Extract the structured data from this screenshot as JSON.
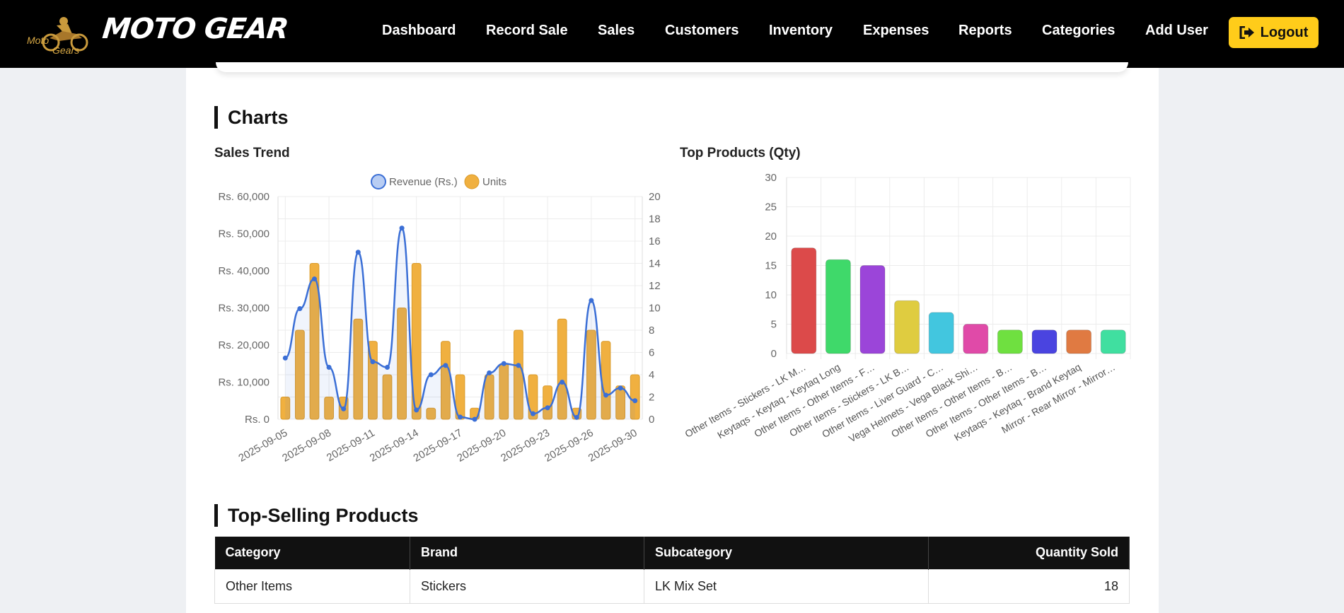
{
  "brand": {
    "name": "MOTO GEAR",
    "logo_text": [
      "Moto",
      "Gears"
    ]
  },
  "nav": [
    {
      "label": "Dashboard"
    },
    {
      "label": "Record Sale"
    },
    {
      "label": "Sales"
    },
    {
      "label": "Customers"
    },
    {
      "label": "Inventory"
    },
    {
      "label": "Expenses"
    },
    {
      "label": "Reports"
    },
    {
      "label": "Categories"
    },
    {
      "label": "Add User"
    }
  ],
  "logout": {
    "label": "Logout",
    "icon": "sign-out-icon"
  },
  "charts_section": {
    "title": "Charts"
  },
  "colors": {
    "accent": "#ffcc1a",
    "nav_bg": "#000000",
    "line": "#3b6fd6",
    "bar": "#f0b040"
  },
  "chart_data": [
    {
      "type": "bar+line",
      "title": "Sales Trend",
      "legend": [
        "Revenue (Rs.)",
        "Units"
      ],
      "legend_position": "top",
      "x_tick_labels": [
        "2025-09-05",
        "2025-09-08",
        "2025-09-11",
        "2025-09-14",
        "2025-09-17",
        "2025-09-20",
        "2025-09-23",
        "2025-09-26",
        "2025-09-30"
      ],
      "y_left_ticks": [
        "Rs. 0",
        "Rs. 10,000",
        "Rs. 20,000",
        "Rs. 30,000",
        "Rs. 40,000",
        "Rs. 50,000",
        "Rs. 60,000"
      ],
      "y_right_ticks": [
        "0",
        "2",
        "4",
        "6",
        "8",
        "10",
        "12",
        "14",
        "16",
        "18",
        "20"
      ],
      "y_left_lim": [
        0,
        60000
      ],
      "y_right_lim": [
        0,
        20
      ],
      "grid": true,
      "series": [
        {
          "name": "Units",
          "axis": "right",
          "values": [
            2,
            8,
            14,
            2,
            2,
            9,
            7,
            4,
            10,
            14,
            1,
            7,
            4,
            1,
            4,
            5,
            8,
            4,
            3,
            9,
            1,
            8,
            7,
            3,
            4
          ]
        },
        {
          "name": "Revenue (Rs.)",
          "axis": "left",
          "values": [
            16500,
            29800,
            37800,
            14000,
            2800,
            45000,
            15500,
            14000,
            51500,
            2500,
            12000,
            14500,
            600,
            0,
            12500,
            15000,
            14500,
            1500,
            3100,
            10000,
            500,
            32000,
            6500,
            8400,
            5000
          ]
        }
      ]
    },
    {
      "type": "bar",
      "title": "Top Products (Qty)",
      "categories": [
        "Other Items - Stickers - LK M…",
        "Keytaqs - Keytaq - Keytaq Long",
        "Other Items - Other Items - F…",
        "Other Items - Stickers - LK B…",
        "Other Items - Liver Guard - C…",
        "Vega Helmets - Vega Black Shi…",
        "Other Items - Other Items - B…",
        "Other Items - Other Items - B…",
        "Keytaqs - Keytaq - Brand Keytaq",
        "Mirror - Rear Mirror - Mirror…"
      ],
      "values": [
        18,
        16,
        15,
        9,
        7,
        5,
        4,
        4,
        4,
        4
      ],
      "colors": [
        "#dc4a4a",
        "#3fd96a",
        "#9b45d9",
        "#dfcc40",
        "#42c6df",
        "#e04aa8",
        "#6fe040",
        "#4a44e0",
        "#e07a42",
        "#40dfa0"
      ],
      "ylim": [
        0,
        30
      ],
      "y_ticks": [
        "0",
        "5",
        "10",
        "15",
        "20",
        "25",
        "30"
      ],
      "grid": true
    }
  ],
  "top_selling": {
    "title": "Top-Selling Products",
    "columns": [
      "Category",
      "Brand",
      "Subcategory",
      "Quantity Sold"
    ],
    "rows": [
      [
        "Other Items",
        "Stickers",
        "LK Mix Set",
        "18"
      ]
    ]
  }
}
